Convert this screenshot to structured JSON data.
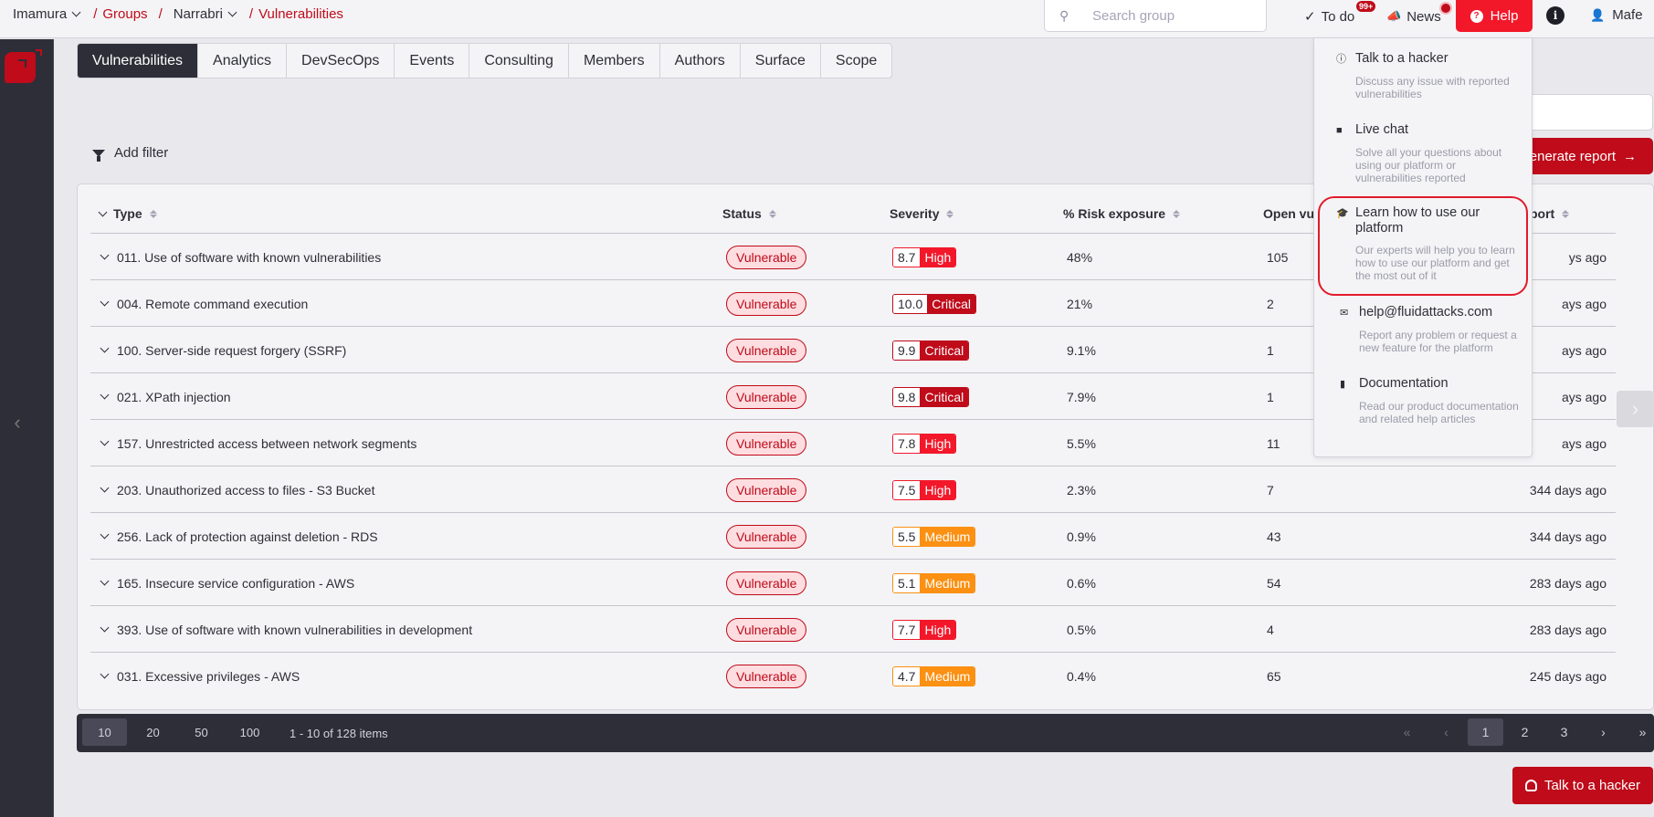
{
  "topbar": {
    "breadcrumb": {
      "organization": "Imamura",
      "groups_link": "Groups",
      "group": "Narrabri",
      "current": "Vulnerabilities",
      "separator": "/"
    },
    "search": {
      "placeholder": "Search group",
      "value": ""
    },
    "todo": {
      "label": "To do",
      "badge": "99+"
    },
    "news": {
      "label": "News"
    },
    "help": {
      "label": "Help"
    },
    "user": {
      "name": "Mafe"
    }
  },
  "tabs": [
    {
      "label": "Vulnerabilities",
      "active": true
    },
    {
      "label": "Analytics"
    },
    {
      "label": "DevSecOps"
    },
    {
      "label": "Events"
    },
    {
      "label": "Consulting"
    },
    {
      "label": "Members"
    },
    {
      "label": "Authors"
    },
    {
      "label": "Surface"
    },
    {
      "label": "Scope"
    }
  ],
  "toolbar": {
    "add_filter": "Add filter",
    "generate_report": "Generate report"
  },
  "table": {
    "columns": [
      "Type",
      "Status",
      "Severity",
      "% Risk exposure",
      "Open vul",
      "port"
    ],
    "rows": [
      {
        "type": "011. Use of software with known vulnerabilities",
        "status": "Vulnerable",
        "score": "8.7",
        "level": "High",
        "risk": "48%",
        "open": "105",
        "last_report": "ys ago"
      },
      {
        "type": "004. Remote command execution",
        "status": "Vulnerable",
        "score": "10.0",
        "level": "Critical",
        "risk": "21%",
        "open": "2",
        "last_report": "ays ago"
      },
      {
        "type": "100. Server-side request forgery (SSRF)",
        "status": "Vulnerable",
        "score": "9.9",
        "level": "Critical",
        "risk": "9.1%",
        "open": "1",
        "last_report": "ays ago"
      },
      {
        "type": "021. XPath injection",
        "status": "Vulnerable",
        "score": "9.8",
        "level": "Critical",
        "risk": "7.9%",
        "open": "1",
        "last_report": "ays ago"
      },
      {
        "type": "157. Unrestricted access between network segments",
        "status": "Vulnerable",
        "score": "7.8",
        "level": "High",
        "risk": "5.5%",
        "open": "11",
        "last_report": "ays ago"
      },
      {
        "type": "203. Unauthorized access to files - S3 Bucket",
        "status": "Vulnerable",
        "score": "7.5",
        "level": "High",
        "risk": "2.3%",
        "open": "7",
        "last_report": "344 days ago"
      },
      {
        "type": "256. Lack of protection against deletion - RDS",
        "status": "Vulnerable",
        "score": "5.5",
        "level": "Medium",
        "risk": "0.9%",
        "open": "43",
        "last_report": "344 days ago"
      },
      {
        "type": "165. Insecure service configuration - AWS",
        "status": "Vulnerable",
        "score": "5.1",
        "level": "Medium",
        "risk": "0.6%",
        "open": "54",
        "last_report": "283 days ago"
      },
      {
        "type": "393. Use of software with known vulnerabilities in development",
        "status": "Vulnerable",
        "score": "7.7",
        "level": "High",
        "risk": "0.5%",
        "open": "4",
        "last_report": "283 days ago"
      },
      {
        "type": "031. Excessive privileges - AWS",
        "status": "Vulnerable",
        "score": "4.7",
        "level": "Medium",
        "risk": "0.4%",
        "open": "65",
        "last_report": "245 days ago"
      }
    ]
  },
  "severity_colors": {
    "Critical": "#bf0b1a",
    "High": "#f2182a",
    "Medium": "#fb9012"
  },
  "pagination": {
    "page_sizes": [
      "10",
      "20",
      "50",
      "100"
    ],
    "active_page_size": "10",
    "info": "1 - 10 of 128 items",
    "pages": [
      "1",
      "2",
      "3"
    ],
    "current_page": "1",
    "first": "«",
    "prev": "‹",
    "next": "›",
    "last": "»"
  },
  "help_menu": [
    {
      "icon": "headset-icon",
      "title": "Talk to a hacker",
      "desc": "Discuss any issue with reported vulnerabilities"
    },
    {
      "icon": "chat-icon",
      "title": "Live chat",
      "desc": "Solve all your questions about using our platform or vulnerabilities reported"
    },
    {
      "icon": "graduation-cap-icon",
      "title": "Learn how to use our platform",
      "desc": "Our experts will help you to learn how to use our platform and get the most out of it",
      "highlighted": true
    },
    {
      "icon": "envelope-icon",
      "title": "help@fluidattacks.com",
      "desc": "Report any problem or request a new feature for the platform"
    },
    {
      "icon": "book-icon",
      "title": "Documentation",
      "desc": "Read our product documentation and related help articles"
    }
  ],
  "floating": {
    "talk_to_hacker": "Talk to a hacker"
  },
  "colors": {
    "brand": "#bf0b1a",
    "help_red": "#f2182a",
    "dark": "#2e2e38"
  }
}
